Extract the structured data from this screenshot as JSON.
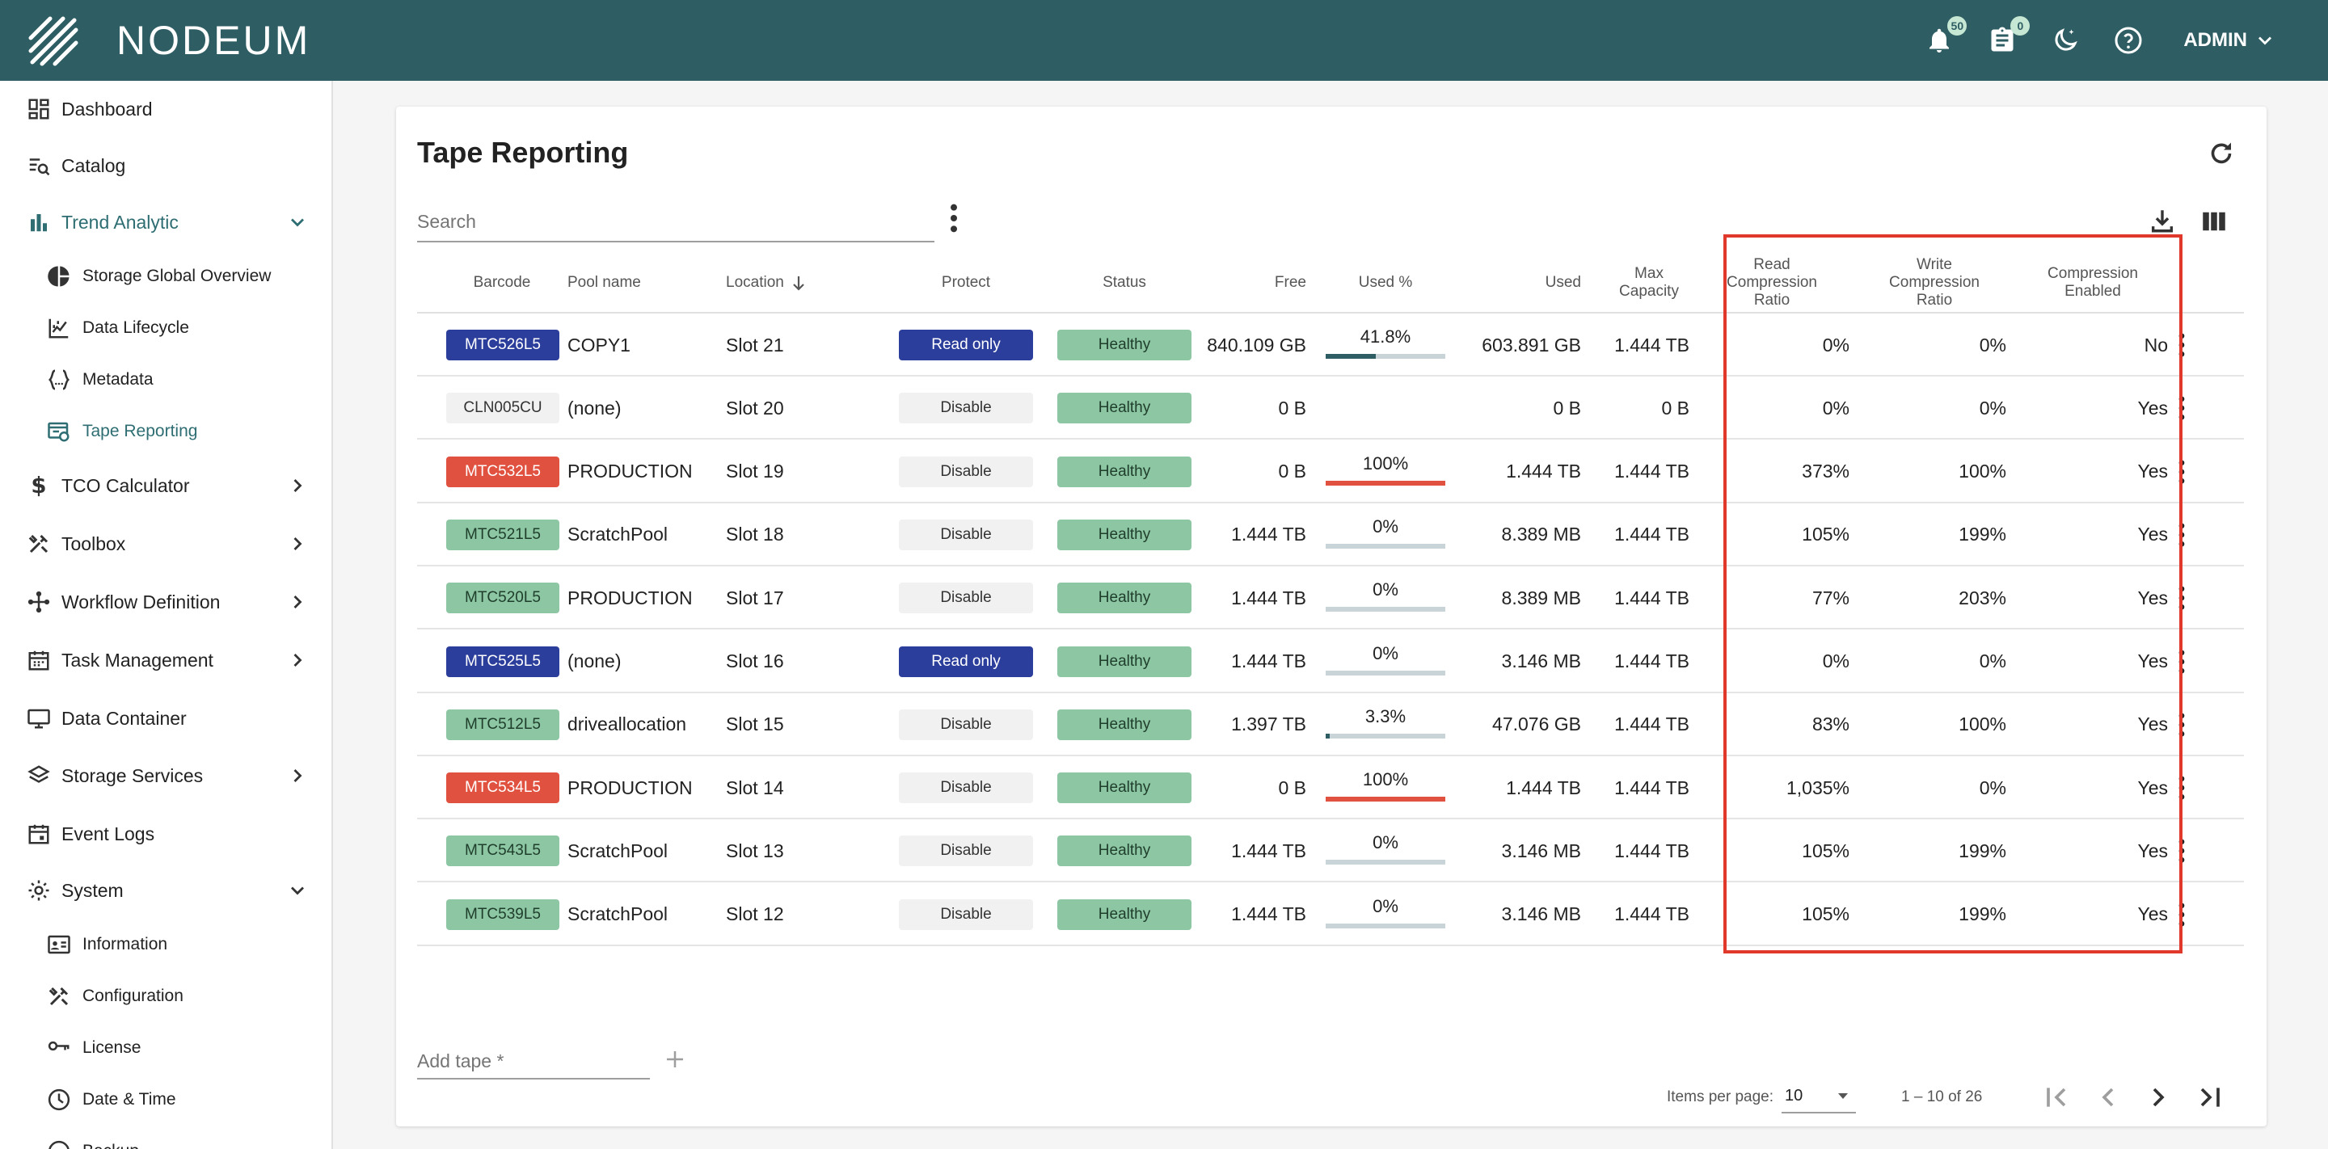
{
  "app": {
    "brand": "NODEUM",
    "notifications_count": "50",
    "tasks_count": "0",
    "user_menu_label": "ADMIN"
  },
  "sidebar": {
    "items": [
      {
        "label": "Dashboard",
        "icon": "dashboard-icon"
      },
      {
        "label": "Catalog",
        "icon": "catalog-search-icon"
      },
      {
        "label": "Trend Analytic",
        "icon": "bar-chart-icon",
        "expanded": true
      },
      {
        "label": "Storage Global Overview",
        "icon": "pie-chart-icon"
      },
      {
        "label": "Data Lifecycle",
        "icon": "line-chart-icon"
      },
      {
        "label": "Metadata",
        "icon": "braces-icon"
      },
      {
        "label": "Tape Reporting",
        "icon": "tape-report-icon",
        "active": true
      },
      {
        "label": "TCO Calculator",
        "icon": "dollar-icon"
      },
      {
        "label": "Toolbox",
        "icon": "tools-icon"
      },
      {
        "label": "Workflow Definition",
        "icon": "workflow-icon"
      },
      {
        "label": "Task Management",
        "icon": "calendar-icon"
      },
      {
        "label": "Data Container",
        "icon": "monitor-icon"
      },
      {
        "label": "Storage Services",
        "icon": "layers-icon"
      },
      {
        "label": "Event Logs",
        "icon": "event-calendar-icon"
      },
      {
        "label": "System",
        "icon": "gear-icon",
        "expanded": true
      },
      {
        "label": "Information",
        "icon": "id-card-icon"
      },
      {
        "label": "Configuration",
        "icon": "wrench-icon"
      },
      {
        "label": "License",
        "icon": "key-icon"
      },
      {
        "label": "Date & Time",
        "icon": "clock-icon"
      },
      {
        "label": "Backup",
        "icon": "backup-icon"
      }
    ]
  },
  "page": {
    "title": "Tape Reporting",
    "search_placeholder": "Search",
    "add_tape_placeholder": "Add tape *"
  },
  "table": {
    "columns": {
      "barcode": "Barcode",
      "pool": "Pool name",
      "location": "Location",
      "protect": "Protect",
      "status": "Status",
      "free": "Free",
      "used_pct": "Used %",
      "used": "Used",
      "max_capacity": "Max Capacity",
      "read_ratio": "Read Compression Ratio",
      "write_ratio": "Write Compression Ratio",
      "compression": "Compression Enabled"
    },
    "rows": [
      {
        "barcode": "MTC526L5",
        "barcode_color": "blue",
        "pool": "COPY1",
        "location": "Slot 21",
        "protect": "Read only",
        "status": "Healthy",
        "free": "840.109 GB",
        "used_pct": "41.8%",
        "used_fraction": 0.418,
        "used": "603.891 GB",
        "max": "1.444 TB",
        "read": "0%",
        "write": "0%",
        "comp": "No"
      },
      {
        "barcode": "CLN005CU",
        "barcode_color": "grey",
        "pool": "(none)",
        "location": "Slot 20",
        "protect": "Disable",
        "status": "Healthy",
        "free": "0 B",
        "used_pct": "",
        "used_fraction": null,
        "used": "0 B",
        "max": "0 B",
        "read": "0%",
        "write": "0%",
        "comp": "Yes"
      },
      {
        "barcode": "MTC532L5",
        "barcode_color": "red",
        "pool": "PRODUCTION",
        "location": "Slot 19",
        "protect": "Disable",
        "status": "Healthy",
        "free": "0 B",
        "used_pct": "100%",
        "used_fraction": 1.0,
        "used": "1.444 TB",
        "max": "1.444 TB",
        "read": "373%",
        "write": "100%",
        "comp": "Yes"
      },
      {
        "barcode": "MTC521L5",
        "barcode_color": "green",
        "pool": "ScratchPool",
        "location": "Slot 18",
        "protect": "Disable",
        "status": "Healthy",
        "free": "1.444 TB",
        "used_pct": "0%",
        "used_fraction": 0.0,
        "used": "8.389 MB",
        "max": "1.444 TB",
        "read": "105%",
        "write": "199%",
        "comp": "Yes"
      },
      {
        "barcode": "MTC520L5",
        "barcode_color": "green",
        "pool": "PRODUCTION",
        "location": "Slot 17",
        "protect": "Disable",
        "status": "Healthy",
        "free": "1.444 TB",
        "used_pct": "0%",
        "used_fraction": 0.0,
        "used": "8.389 MB",
        "max": "1.444 TB",
        "read": "77%",
        "write": "203%",
        "comp": "Yes"
      },
      {
        "barcode": "MTC525L5",
        "barcode_color": "blue",
        "pool": "(none)",
        "location": "Slot 16",
        "protect": "Read only",
        "status": "Healthy",
        "free": "1.444 TB",
        "used_pct": "0%",
        "used_fraction": 0.0,
        "used": "3.146 MB",
        "max": "1.444 TB",
        "read": "0%",
        "write": "0%",
        "comp": "Yes"
      },
      {
        "barcode": "MTC512L5",
        "barcode_color": "green",
        "pool": "driveallocation",
        "location": "Slot 15",
        "protect": "Disable",
        "status": "Healthy",
        "free": "1.397 TB",
        "used_pct": "3.3%",
        "used_fraction": 0.033,
        "used": "47.076 GB",
        "max": "1.444 TB",
        "read": "83%",
        "write": "100%",
        "comp": "Yes"
      },
      {
        "barcode": "MTC534L5",
        "barcode_color": "red",
        "pool": "PRODUCTION",
        "location": "Slot 14",
        "protect": "Disable",
        "status": "Healthy",
        "free": "0 B",
        "used_pct": "100%",
        "used_fraction": 1.0,
        "used": "1.444 TB",
        "max": "1.444 TB",
        "read": "1,035%",
        "write": "0%",
        "comp": "Yes"
      },
      {
        "barcode": "MTC543L5",
        "barcode_color": "green",
        "pool": "ScratchPool",
        "location": "Slot 13",
        "protect": "Disable",
        "status": "Healthy",
        "free": "1.444 TB",
        "used_pct": "0%",
        "used_fraction": 0.0,
        "used": "3.146 MB",
        "max": "1.444 TB",
        "read": "105%",
        "write": "199%",
        "comp": "Yes"
      },
      {
        "barcode": "MTC539L5",
        "barcode_color": "green",
        "pool": "ScratchPool",
        "location": "Slot 12",
        "protect": "Disable",
        "status": "Healthy",
        "free": "1.444 TB",
        "used_pct": "0%",
        "used_fraction": 0.0,
        "used": "3.146 MB",
        "max": "1.444 TB",
        "read": "105%",
        "write": "199%",
        "comp": "Yes"
      }
    ]
  },
  "pagination": {
    "items_per_page_label": "Items per page:",
    "items_per_page": "10",
    "range": "1 – 10 of 26"
  },
  "colors": {
    "topbar": "#2e5e63",
    "healthy": "#8cc6a3",
    "read_only": "#2c3e9b",
    "barcode_red": "#e05140",
    "highlight_box": "#e0382b"
  }
}
